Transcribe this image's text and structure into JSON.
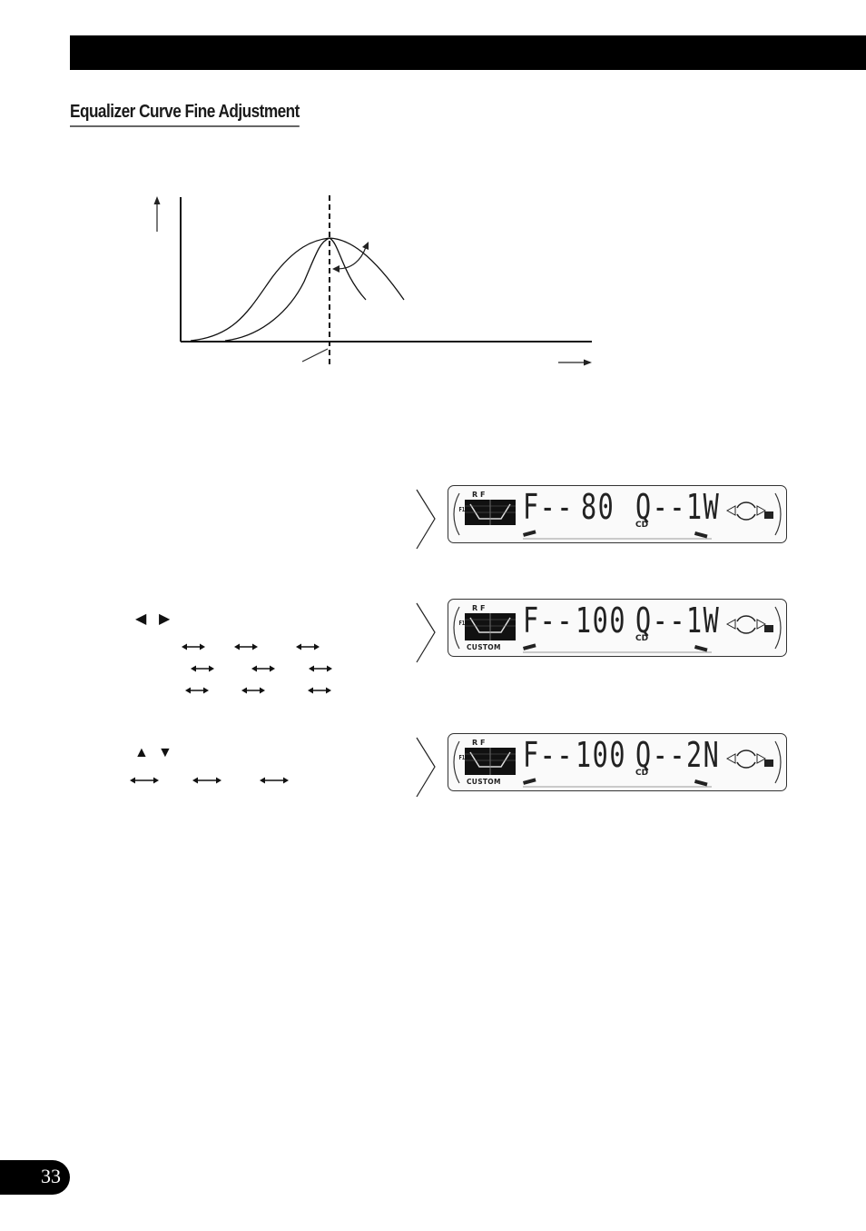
{
  "header": {
    "section_title": "Equalizer Curve Fine Adjustment"
  },
  "diagram": {
    "description": "EQ curve peak with narrow and wide Q curves around center frequency",
    "axis_arrows": [
      "y-axis-up-arrow",
      "x-axis-right-arrow"
    ],
    "curves": [
      "wide-q-curve",
      "narrow-q-curve"
    ],
    "center_line": "dashed-center-frequency-line",
    "adjust_arrow": "curved-double-arrow"
  },
  "steps": {
    "left_right_buttons": {
      "left_glyph": "◀",
      "right_glyph": "▶"
    },
    "up_down_buttons": {
      "up_glyph": "▲",
      "down_glyph": "▼"
    },
    "double_arrow_glyph": "⟷"
  },
  "displays": [
    {
      "freq_label": "F--",
      "freq_value": "80",
      "q_label": "Q--",
      "q_value": "1W",
      "source": "CD",
      "rf": "R F",
      "f1": "F1",
      "custom": ""
    },
    {
      "freq_label": "F--",
      "freq_value": "100",
      "q_label": "Q--",
      "q_value": "1W",
      "source": "CD",
      "rf": "R F",
      "f1": "F1",
      "custom": "CUSTOM"
    },
    {
      "freq_label": "F--",
      "freq_value": "100",
      "q_label": "Q--",
      "q_value": "2N",
      "source": "CD",
      "rf": "R F",
      "f1": "F1",
      "custom": "CUSTOM"
    }
  ],
  "footer": {
    "page_number": "33"
  }
}
